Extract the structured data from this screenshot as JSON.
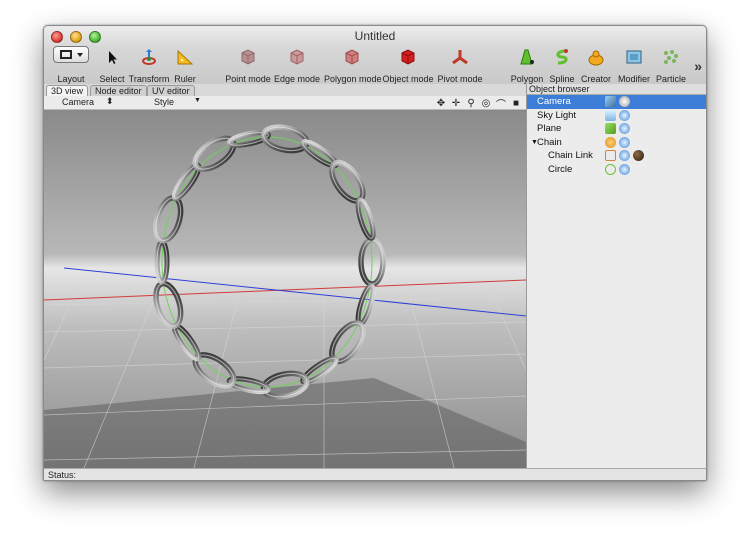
{
  "window": {
    "title": "Untitled"
  },
  "toolbar": {
    "layout": "Layout",
    "select": "Select",
    "transform": "Transform",
    "ruler": "Ruler",
    "point_mode": "Point mode",
    "edge_mode": "Edge mode",
    "polygon_mode": "Polygon mode",
    "object_mode": "Object mode",
    "pivot_mode": "Pivot mode",
    "polygon": "Polygon",
    "spline": "Spline",
    "creator": "Creator",
    "modifier": "Modifier",
    "particle": "Particle",
    "more": "»"
  },
  "tabs": [
    "3D view",
    "Node editor",
    "UV editor"
  ],
  "viewport": {
    "camera": "Camera",
    "style": "Style"
  },
  "object_browser": {
    "title": "Object browser",
    "items": [
      "Camera",
      "Sky Light",
      "Plane",
      "Chain",
      "Chain Link",
      "Circle"
    ]
  },
  "status": {
    "label": "Status:"
  },
  "colors": {
    "selection": "#3d7ed8",
    "x_axis": "#d23a3a",
    "z_axis": "#2f3fd8",
    "chain_path": "#6fd25a"
  }
}
